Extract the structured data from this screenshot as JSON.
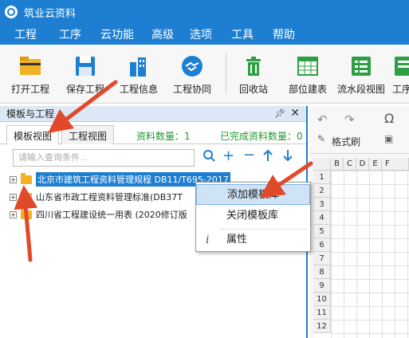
{
  "app": {
    "title": "筑业云资料"
  },
  "menu": [
    "工程",
    "工序",
    "云功能",
    "高级",
    "选项",
    "工具",
    "帮助"
  ],
  "toolbar": {
    "open": "打开工程",
    "save": "保存工程",
    "info": "工程信息",
    "collab": "工程协同",
    "recycle": "回收站",
    "unit": "部位建表",
    "flow": "流水段视图",
    "more": "工序"
  },
  "panel": {
    "title": "模板与工程",
    "pin_icon": "pin-icon",
    "tab_template": "模板视图",
    "tab_project": "工程视图",
    "doc_count": "资料数量：1",
    "done_count": "已完成资料数量：0",
    "search_placeholder": "请输入查询条件..."
  },
  "tree": [
    {
      "label": "北京市建筑工程资料管理规程 DB11/T695-2017",
      "selected": true
    },
    {
      "label": "山东省市政工程资料管理标准(DB37T",
      "selected": false
    },
    {
      "label": "四川省工程建设统一用表 (2020修订版",
      "selected": false
    }
  ],
  "context_menu": {
    "add": "添加模板库",
    "close": "关闭模板库",
    "props": "属性"
  },
  "sheet": {
    "format_brush": "格式刷",
    "cols": [
      "B",
      "C",
      "D",
      "E",
      "F"
    ],
    "rows": [
      "1",
      "2",
      "3",
      "4",
      "5",
      "6",
      "7",
      "8",
      "9",
      "10",
      "11",
      "12"
    ]
  },
  "colors": {
    "accent": "#1e7fd2",
    "arrow": "#e04a2a",
    "count_green": "#1f9a2e"
  }
}
